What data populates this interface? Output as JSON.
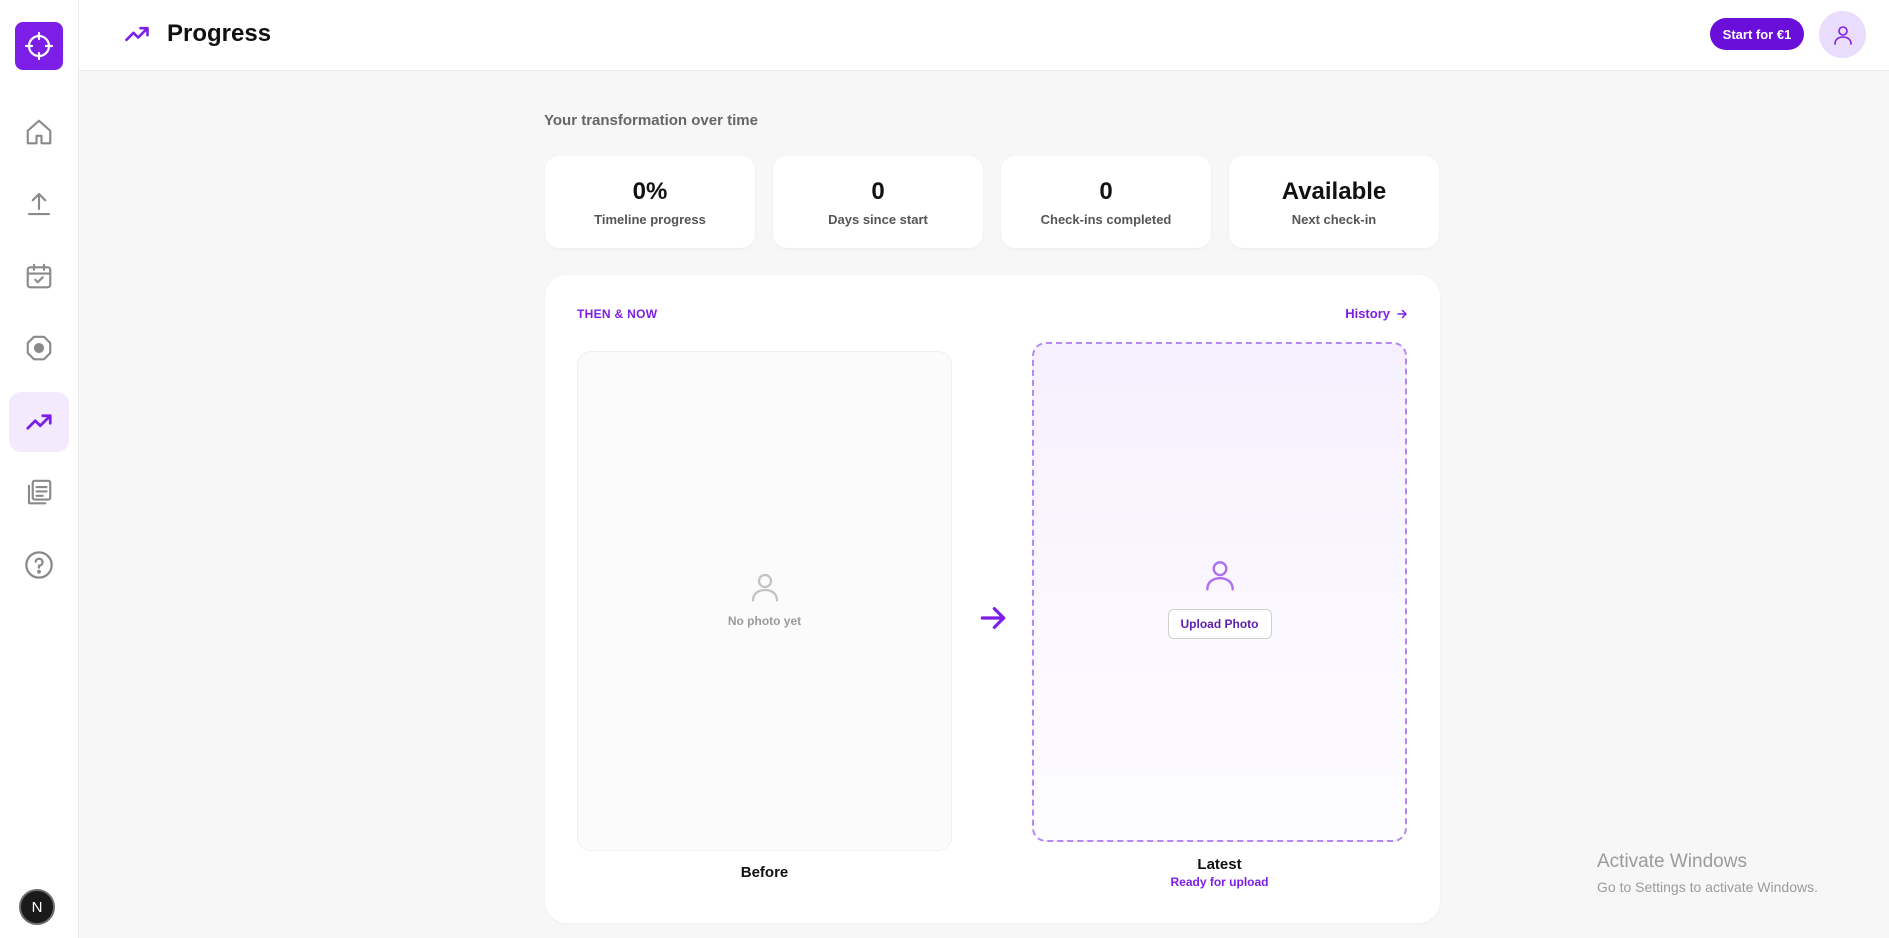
{
  "header": {
    "title": "Progress",
    "cta_label": "Start for €1"
  },
  "sidebar": {
    "items": [
      {
        "name": "home",
        "icon": "home-icon"
      },
      {
        "name": "upload",
        "icon": "upload-icon"
      },
      {
        "name": "calendar",
        "icon": "calendar-check-icon"
      },
      {
        "name": "target",
        "icon": "target-icon"
      },
      {
        "name": "progress",
        "icon": "trending-up-icon",
        "active": true
      },
      {
        "name": "library",
        "icon": "library-icon"
      },
      {
        "name": "help",
        "icon": "help-icon"
      }
    ],
    "bottom_avatar_letter": "N"
  },
  "main": {
    "subtitle": "Your transformation over time",
    "stats": [
      {
        "value": "0%",
        "label": "Timeline progress"
      },
      {
        "value": "0",
        "label": "Days since start"
      },
      {
        "value": "0",
        "label": "Check-ins completed"
      },
      {
        "value": "Available",
        "label": "Next check-in"
      }
    ],
    "comparison": {
      "label": "THEN & NOW",
      "history_link": "History",
      "before_empty_text": "No photo yet",
      "before_caption": "Before",
      "latest_caption": "Latest",
      "latest_status": "Ready for upload",
      "upload_button": "Upload Photo"
    }
  },
  "watermark": {
    "title": "Activate Windows",
    "subtitle": "Go to Settings to activate Windows."
  },
  "colors": {
    "accent": "#7c1ee6",
    "cta": "#6a0fd9",
    "background": "#f7f7f7"
  }
}
